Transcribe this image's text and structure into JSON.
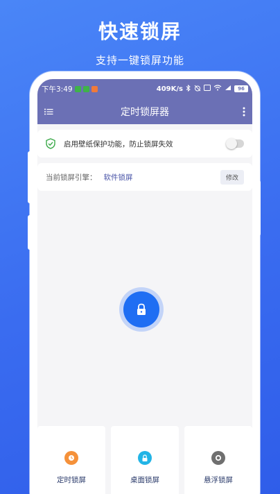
{
  "promo": {
    "title": "快速锁屏",
    "subtitle": "支持一键锁屏功能"
  },
  "status_bar": {
    "time": "下午3:49",
    "speed": "409K/s",
    "battery": "96"
  },
  "app_bar": {
    "title": "定时锁屏器"
  },
  "protect_card": {
    "label": "启用壁纸保护功能，防止锁屏失效",
    "toggle_on": false
  },
  "engine_card": {
    "label": "当前锁屏引擎：",
    "value": "软件锁屏",
    "modify_label": "修改"
  },
  "functions": [
    {
      "label": "定时锁屏",
      "color": "#f5913a"
    },
    {
      "label": "桌面锁屏",
      "color": "#22b4e6"
    },
    {
      "label": "悬浮锁屏",
      "color": "#6f6f6f"
    }
  ],
  "colors": {
    "app_bar": "#6b70b5",
    "accent": "#1f6ef3",
    "background_gradient_start": "#4a86f7",
    "background_gradient_end": "#2f5de9"
  }
}
